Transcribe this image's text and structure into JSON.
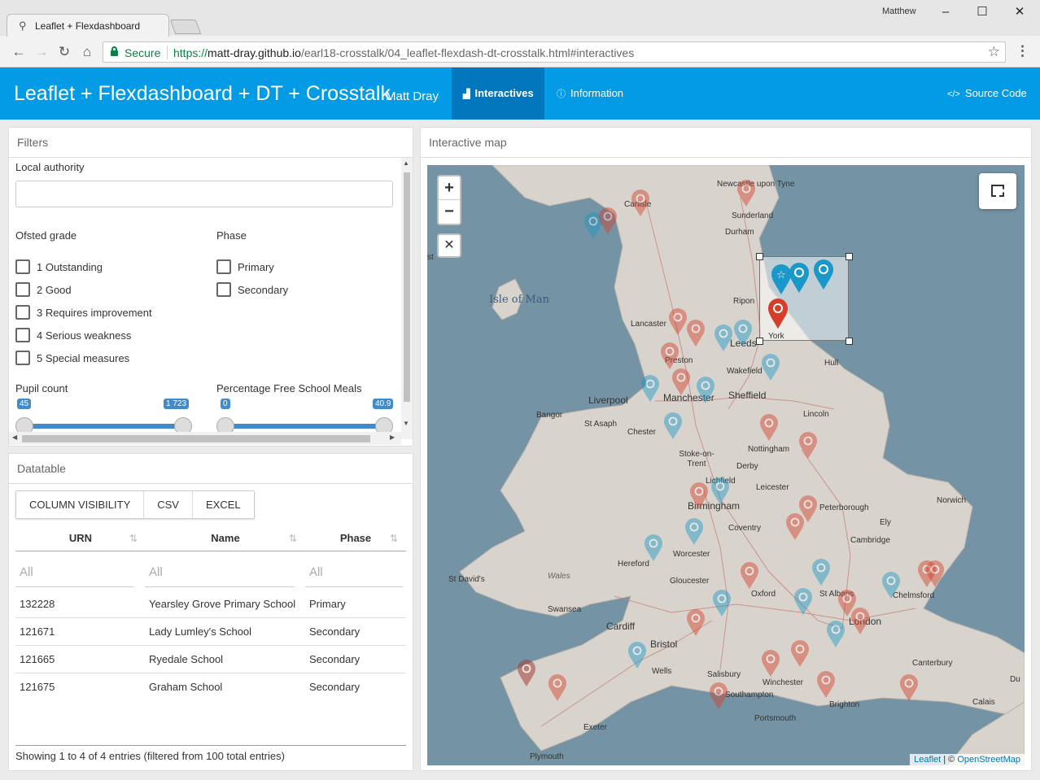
{
  "browser": {
    "tab_title": "Leaflet + Flexdashboard",
    "profile": "Matthew",
    "secure_label": "Secure",
    "url_scheme": "https://",
    "url_host": "matt-dray.github.io",
    "url_path": "/earl18-crosstalk/04_leaflet-flexdash-dt-crosstalk.html#interactives"
  },
  "navbar": {
    "title": "Leaflet + Flexdashboard + DT + Crosstalk",
    "author": "Matt Dray",
    "tabs": [
      {
        "label": "Interactives",
        "active": true
      },
      {
        "label": "Information",
        "active": false
      }
    ],
    "source_code": "Source Code"
  },
  "filters": {
    "title": "Filters",
    "local_authority_label": "Local authority",
    "local_authority_value": "",
    "ofsted_label": "Ofsted grade",
    "ofsted_options": [
      "1 Outstanding",
      "2 Good",
      "3 Requires improvement",
      "4 Serious weakness",
      "5 Special measures"
    ],
    "phase_label": "Phase",
    "phase_options": [
      "Primary",
      "Secondary"
    ],
    "pupil_label": "Pupil count",
    "pupil_min": "45",
    "pupil_max": "1 723",
    "fsm_label": "Percentage Free School Meals",
    "fsm_min": "0",
    "fsm_max": "40.9"
  },
  "datatable": {
    "title": "Datatable",
    "buttons": [
      "COLUMN VISIBILITY",
      "CSV",
      "EXCEL"
    ],
    "columns": [
      "URN",
      "Name",
      "Phase"
    ],
    "filter_placeholder": "All",
    "rows": [
      [
        "132228",
        "Yearsley Grove Primary School",
        "Primary"
      ],
      [
        "121671",
        "Lady Lumley's School",
        "Secondary"
      ],
      [
        "121665",
        "Ryedale School",
        "Secondary"
      ],
      [
        "121675",
        "Graham School",
        "Secondary"
      ]
    ],
    "info": "Showing 1 to 4 of 4 entries (filtered from 100 total entries)"
  },
  "map": {
    "title": "Interactive map",
    "zoom_in": "+",
    "zoom_out": "−",
    "close": "✕",
    "places": [
      "Newcastle upon Tyne",
      "Carlisle",
      "Sunderland",
      "Durham",
      "Isle of Man",
      "Ripon",
      "York",
      "Lancaster",
      "Leeds",
      "Preston",
      "Wakefield",
      "Hull",
      "Liverpool",
      "Manchester",
      "Sheffield",
      "Bangor",
      "St Asaph",
      "Chester",
      "Lincoln",
      "Stoke-on-Trent",
      "Nottingham",
      "Derby",
      "Lichfield",
      "Leicester",
      "Birmingham",
      "Peterborough",
      "Norwich",
      "Coventry",
      "Ely",
      "Cambridge",
      "Worcester",
      "Hereford",
      "St David's",
      "Wales",
      "Gloucester",
      "Oxford",
      "St Albans",
      "Chelmsford",
      "Swansea",
      "Cardiff",
      "London",
      "Bristol",
      "Wells",
      "Canterbury",
      "Salisbury",
      "Winchester",
      "Southampton",
      "Brighton",
      "Portsmouth",
      "Calais",
      "Exeter",
      "Plymouth",
      "Du",
      "st"
    ],
    "attribution_leaflet": "Leaflet",
    "attribution_sep": " | © ",
    "attribution_osm": "OpenStreetMap"
  },
  "colors": {
    "navbar": "#039be5",
    "navbar_active": "#0277bd",
    "marker_red": "#d63e2a",
    "marker_blue": "#1a98c9"
  }
}
